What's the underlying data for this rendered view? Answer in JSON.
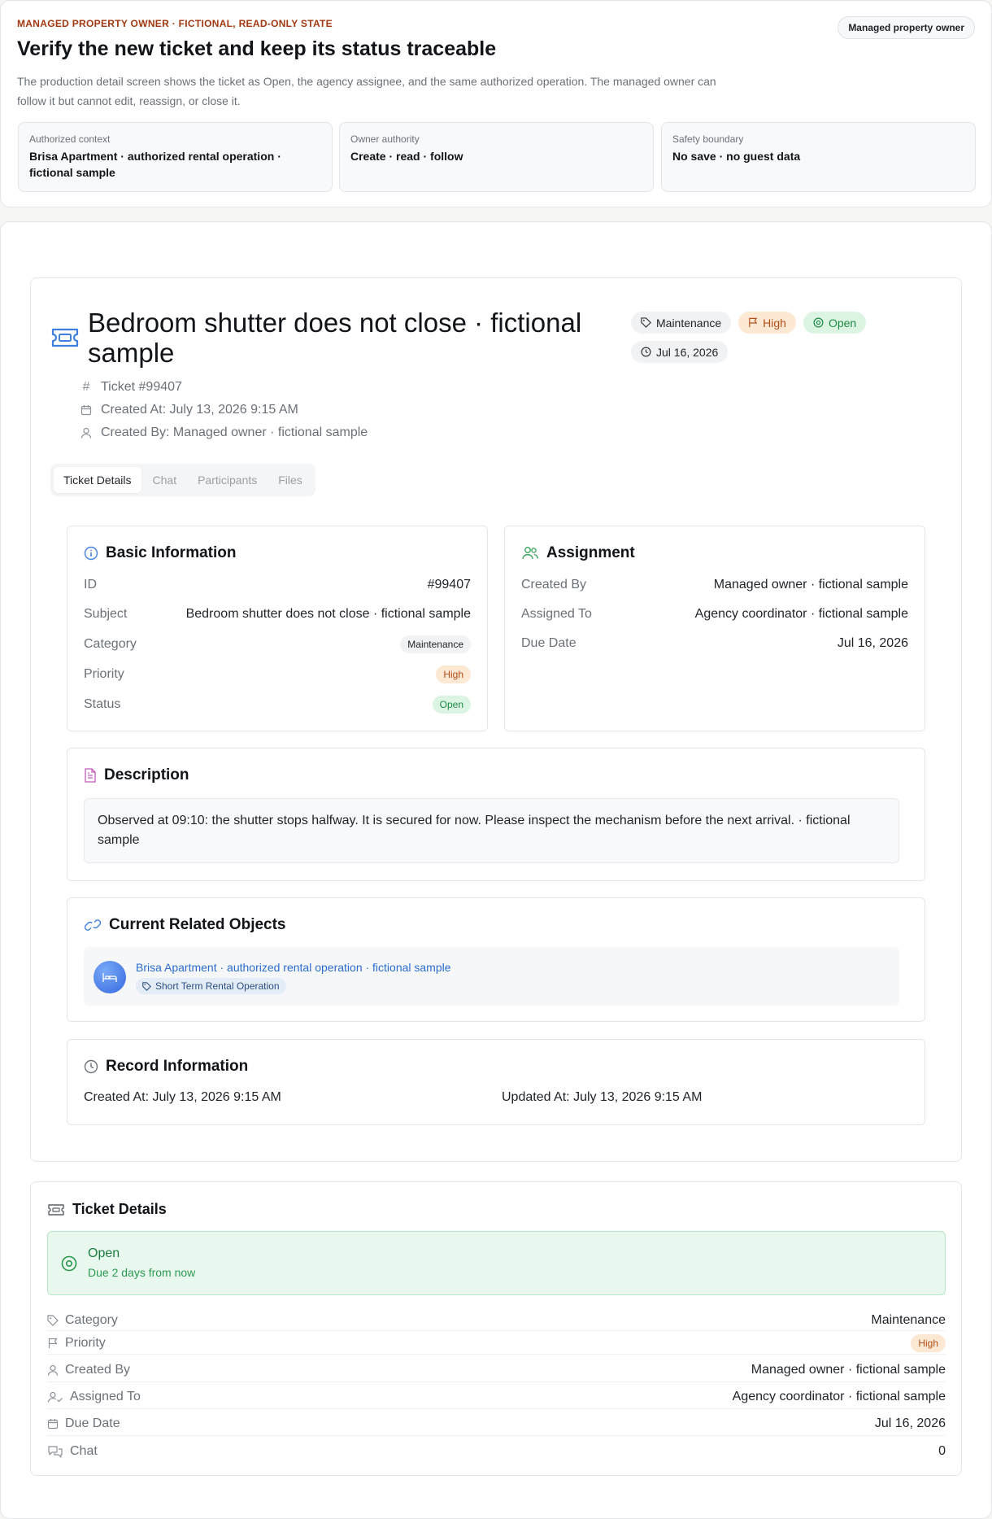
{
  "banner": {
    "eyebrow": "MANAGED PROPERTY OWNER · FICTIONAL, READ-ONLY STATE",
    "role": "Managed property owner",
    "title": "Verify the new ticket and keep its status traceable",
    "description": "The production detail screen shows the ticket as Open, the agency assignee, and the same authorized operation. The managed owner can follow it but cannot edit, reassign, or close it.",
    "context_cards": [
      {
        "label": "Authorized context",
        "value": "Brisa Apartment · authorized rental operation · fictional sample"
      },
      {
        "label": "Owner authority",
        "value": "Create · read · follow"
      },
      {
        "label": "Safety boundary",
        "value": "No save · no guest data"
      }
    ]
  },
  "ticket": {
    "title": "Bedroom shutter does not close · fictional sample",
    "badges": {
      "category": "Maintenance",
      "priority": "High",
      "status": "Open",
      "due": "Jul 16, 2026"
    },
    "meta": {
      "number": "Ticket #99407",
      "created_at": "Created At: July 13, 2026 9:15 AM",
      "created_by": "Created By: Managed owner · fictional sample"
    },
    "tabs": [
      "Ticket Details",
      "Chat",
      "Participants",
      "Files"
    ]
  },
  "basic_info": {
    "heading": "Basic Information",
    "rows": {
      "id_label": "ID",
      "id_value": "#99407",
      "subject_label": "Subject",
      "subject_value": "Bedroom shutter does not close · fictional sample",
      "category_label": "Category",
      "category_value": "Maintenance",
      "priority_label": "Priority",
      "priority_value": "High",
      "status_label": "Status",
      "status_value": "Open"
    }
  },
  "assignment": {
    "heading": "Assignment",
    "created_by_label": "Created By",
    "created_by_value": "Managed owner · fictional sample",
    "assigned_to_label": "Assigned To",
    "assigned_to_value": "Agency coordinator · fictional sample",
    "due_date_label": "Due Date",
    "due_date_value": "Jul 16, 2026"
  },
  "description": {
    "heading": "Description",
    "text": "Observed at 09:10: the shutter stops halfway. It is secured for now. Please inspect the mechanism before the next arrival. · fictional sample"
  },
  "related": {
    "heading": "Current Related Objects",
    "link": "Brisa Apartment · authorized rental operation · fictional sample",
    "tag": "Short Term Rental Operation"
  },
  "record": {
    "heading": "Record Information",
    "created": "Created At: July 13, 2026 9:15 AM",
    "updated": "Updated At: July 13, 2026 9:15 AM"
  },
  "details": {
    "heading": "Ticket Details",
    "status": "Open",
    "status_sub": "Due 2 days from now",
    "rows": {
      "category_label": "Category",
      "category_value": "Maintenance",
      "priority_label": "Priority",
      "priority_value": "High",
      "created_by_label": "Created By",
      "created_by_value": "Managed owner · fictional sample",
      "assigned_to_label": "Assigned To",
      "assigned_to_value": "Agency coordinator · fictional sample",
      "due_date_label": "Due Date",
      "due_date_value": "Jul 16, 2026",
      "chat_label": "Chat",
      "chat_value": "0"
    }
  },
  "colors": {
    "eyebrow": "#a2380f",
    "open_green": "#1f8a47",
    "high_orange": "#b1501b",
    "link_blue": "#2b6ccf"
  }
}
